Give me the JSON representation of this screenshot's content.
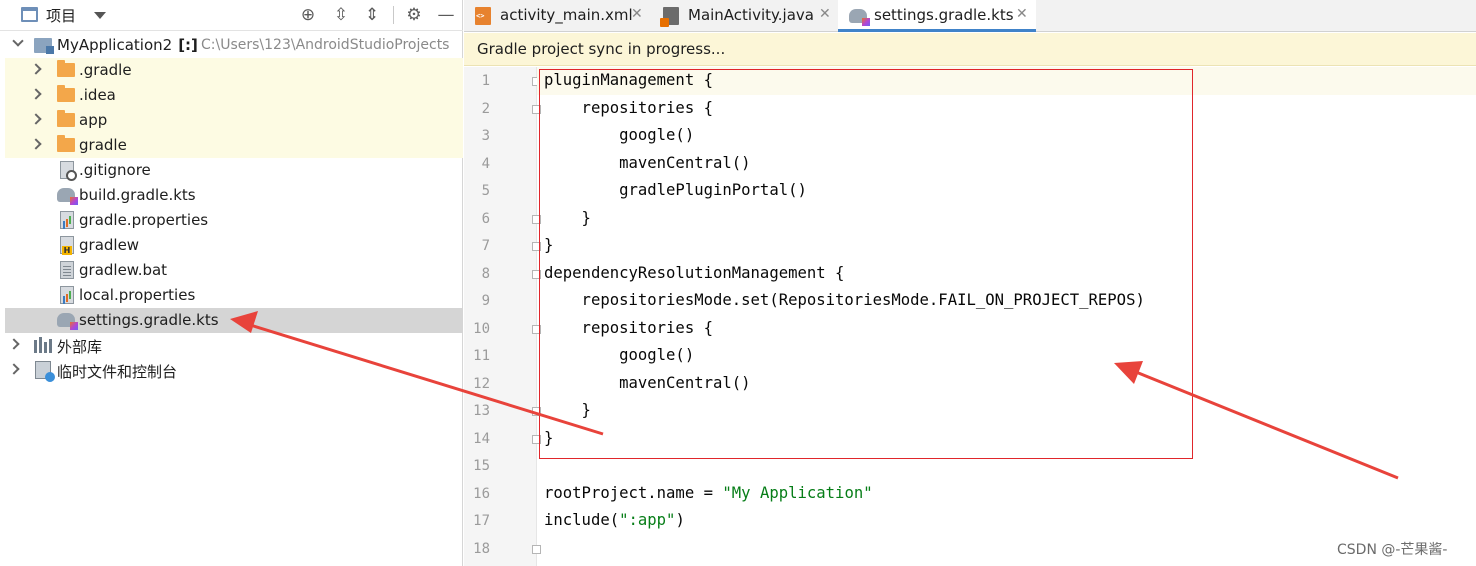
{
  "project_panel": {
    "title": "项目",
    "toolbar_icons": [
      "locate-icon",
      "expand-all-icon",
      "collapse-all-icon",
      "gear-icon",
      "minimize-icon"
    ],
    "tree": [
      {
        "label": "MyApplication2",
        "bracket": "[:]",
        "path": "C:\\Users\\123\\AndroidStudioProjects",
        "icon": "module-icon",
        "expanded": true
      },
      {
        "label": ".gradle",
        "icon": "folder-icon",
        "expandable": true
      },
      {
        "label": ".idea",
        "icon": "folder-icon",
        "expandable": true
      },
      {
        "label": "app",
        "icon": "folder-icon",
        "expandable": true
      },
      {
        "label": "gradle",
        "icon": "folder-icon",
        "expandable": true
      },
      {
        "label": ".gitignore",
        "icon": "gitignore-file-icon"
      },
      {
        "label": "build.gradle.kts",
        "icon": "gradle-kts-icon"
      },
      {
        "label": "gradle.properties",
        "icon": "properties-file-icon"
      },
      {
        "label": "gradlew",
        "icon": "shell-script-icon"
      },
      {
        "label": "gradlew.bat",
        "icon": "text-file-icon"
      },
      {
        "label": "local.properties",
        "icon": "properties-file-icon"
      },
      {
        "label": "settings.gradle.kts",
        "icon": "gradle-kts-icon",
        "selected": true
      },
      {
        "label": "外部库",
        "icon": "library-icon",
        "expandable": true
      },
      {
        "label": "临时文件和控制台",
        "icon": "scratch-icon",
        "expandable": true
      }
    ]
  },
  "tabs": [
    {
      "label": "activity_main.xml",
      "icon": "xml-file-icon"
    },
    {
      "label": "MainActivity.java",
      "icon": "java-file-icon"
    },
    {
      "label": "settings.gradle.kts",
      "icon": "gradle-kts-icon",
      "active": true
    }
  ],
  "banner": {
    "text": "Gradle project sync in progress..."
  },
  "code": {
    "line_numbers": [
      "1",
      "2",
      "3",
      "4",
      "5",
      "6",
      "7",
      "8",
      "9",
      "10",
      "11",
      "12",
      "13",
      "14",
      "15",
      "16",
      "17",
      "18"
    ],
    "lines": [
      "pluginManagement {",
      "    repositories {",
      "        google()",
      "        mavenCentral()",
      "        gradlePluginPortal()",
      "    }",
      "}",
      "dependencyResolutionManagement {",
      "    repositoriesMode.set(RepositoriesMode.FAIL_ON_PROJECT_REPOS)",
      "    repositories {",
      "        google()",
      "        mavenCentral()",
      "    }",
      "}",
      "",
      "rootProject.name = ",
      "include(",
      ""
    ],
    "strings": {
      "root_project_name": "\"My Application\"",
      "include_arg": "\":app\"",
      "include_close": ")"
    }
  },
  "watermark": "CSDN @-芒果酱-",
  "colors": {
    "highlight_box": "#e0262b",
    "arrow": "#e8433b",
    "string_literal": "#067d17",
    "active_tab_underline": "#4083c9",
    "banner_bg": "#fcf6d7"
  }
}
